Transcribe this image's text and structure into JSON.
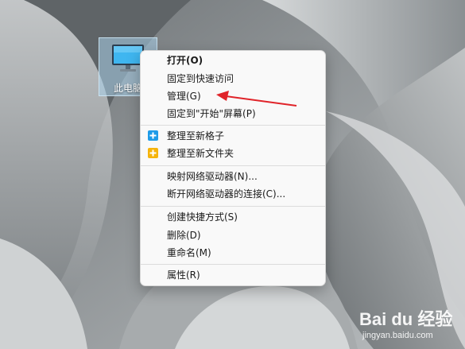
{
  "desktop": {
    "icon_label": "此电脑"
  },
  "context_menu": {
    "items": [
      {
        "label": "打开(O)",
        "bold": true,
        "icon": ""
      },
      {
        "label": "固定到快速访问",
        "bold": false,
        "icon": ""
      },
      {
        "label": "管理(G)",
        "bold": false,
        "icon": ""
      },
      {
        "label": "固定到\"开始\"屏幕(P)",
        "bold": false,
        "icon": ""
      },
      {
        "label": "整理至新格子",
        "bold": false,
        "icon": "blue-plus-icon"
      },
      {
        "label": "整理至新文件夹",
        "bold": false,
        "icon": "yellow-folder-plus-icon"
      },
      {
        "label": "映射网络驱动器(N)...",
        "bold": false,
        "icon": ""
      },
      {
        "label": "断开网络驱动器的连接(C)...",
        "bold": false,
        "icon": ""
      },
      {
        "label": "创建快捷方式(S)",
        "bold": false,
        "icon": ""
      },
      {
        "label": "删除(D)",
        "bold": false,
        "icon": ""
      },
      {
        "label": "重命名(M)",
        "bold": false,
        "icon": ""
      },
      {
        "label": "属性(R)",
        "bold": false,
        "icon": ""
      }
    ]
  },
  "annotation": {
    "arrow_color": "#e0242a"
  },
  "watermark": {
    "logo": "Bai du 经验",
    "url": "jingyan.baidu.com"
  },
  "colors": {
    "menu_bg": "#f9f9f9",
    "accent_blue": "#1e9be8",
    "accent_yellow": "#f5b40c"
  }
}
